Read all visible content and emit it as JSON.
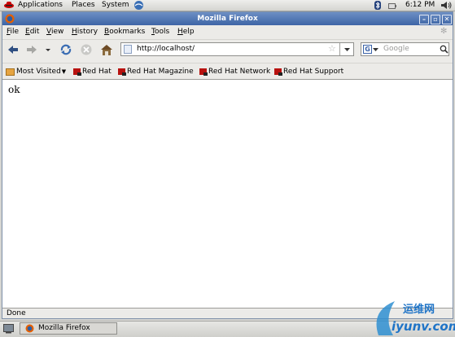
{
  "top_panel": {
    "applications": "Applications",
    "places": "Places",
    "system": "System",
    "clock": "6:12 PM"
  },
  "window": {
    "title": "Mozilla Firefox"
  },
  "menu": {
    "file": "ile",
    "file_key": "F",
    "edit": "dit",
    "edit_key": "E",
    "view": "iew",
    "view_key": "V",
    "history": "istory",
    "history_key": "H",
    "bookmarks": "ookmarks",
    "bookmarks_key": "B",
    "tools": "ools",
    "tools_key": "T",
    "help": "elp",
    "help_key": "H"
  },
  "nav": {
    "url": "http://localhost/",
    "search_placeholder": "Google",
    "search_engine_letter": "G"
  },
  "bookmarks": {
    "most_visited": "Most Visited",
    "items": [
      "Red Hat",
      "Red Hat Magazine",
      "Red Hat Network",
      "Red Hat Support"
    ]
  },
  "page": {
    "text": "ok"
  },
  "status": {
    "text": "Done"
  },
  "taskbar": {
    "window_label": "Mozilla Firefox"
  },
  "watermark": {
    "cn": "运维网",
    "domain": "iyunv.com"
  }
}
